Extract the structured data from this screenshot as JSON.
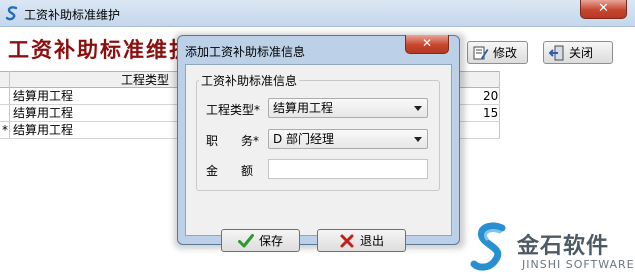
{
  "window": {
    "title": "工资补助标准维护",
    "close_glyph": "✕"
  },
  "heading": "工资补助标准维护",
  "toolbar": {
    "edit_label": "修改",
    "close_label": "关闭"
  },
  "grid": {
    "column_header": "工程类型",
    "rows": [
      {
        "marker": "",
        "type": "结算用工程",
        "value": "20"
      },
      {
        "marker": "",
        "type": "结算用工程",
        "value": "15"
      },
      {
        "marker": "*",
        "type": "结算用工程",
        "value": ""
      }
    ]
  },
  "dialog": {
    "title": "添加工资补助标准信息",
    "close_glyph": "✕",
    "group_title": "工资补助标准信息",
    "fields": {
      "type_label": "工程类型*",
      "type_value": "结算用工程",
      "position_label_1": "职",
      "position_label_2": "务*",
      "position_value": "D 部门经理",
      "amount_label_1": "金",
      "amount_label_2": "额",
      "amount_value": ""
    },
    "save_label": "保存",
    "exit_label": "退出"
  },
  "watermark": {
    "name": "金石软件",
    "sub": "JINSHI SOFTWARE"
  }
}
